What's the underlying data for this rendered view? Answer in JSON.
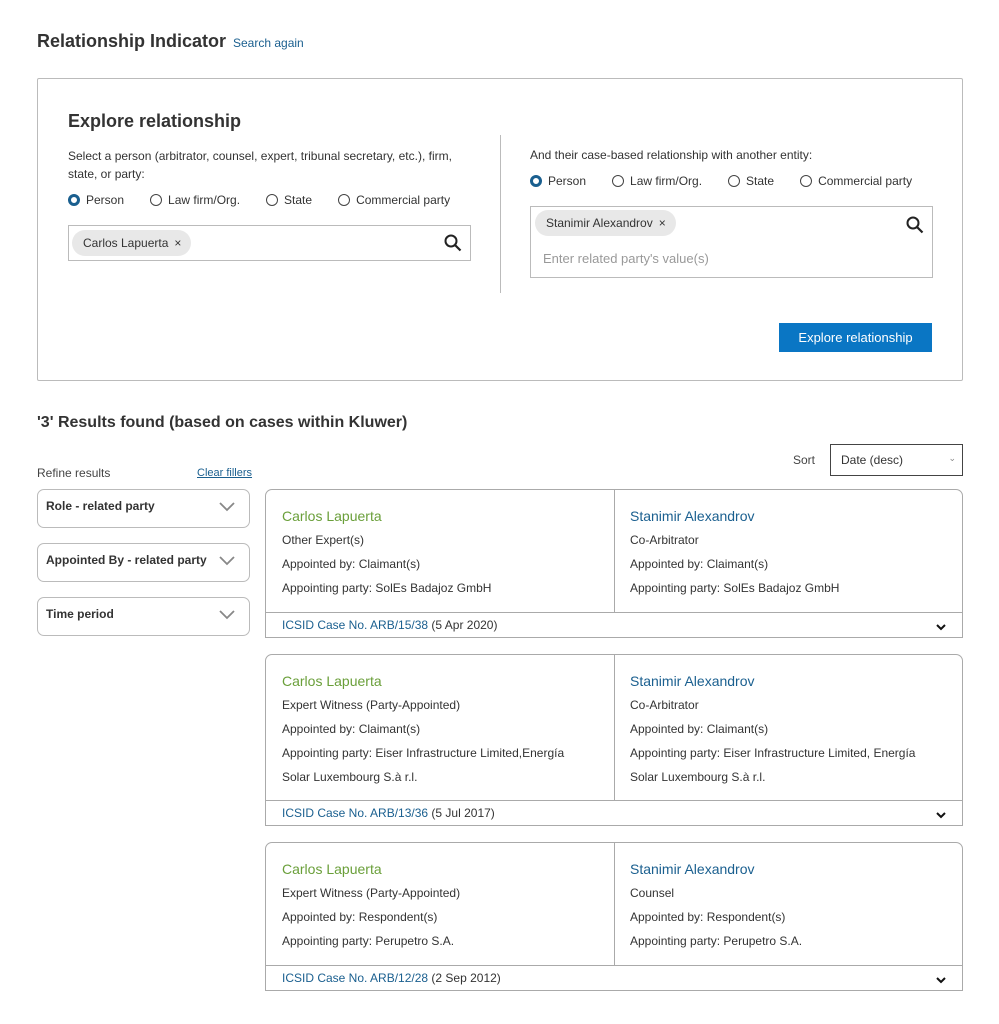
{
  "header": {
    "title": "Relationship Indicator",
    "search_again": "Search again"
  },
  "explore": {
    "title": "Explore relationship",
    "left": {
      "description": "Select a person (arbitrator, counsel, expert, tribunal secretary, etc.), firm, state, or party:",
      "radios": [
        "Person",
        "Law firm/Org.",
        "State",
        "Commercial party"
      ],
      "selected": "Person",
      "chip": "Carlos Lapuerta"
    },
    "right": {
      "description": "And their case-based relationship with another entity:",
      "radios": [
        "Person",
        "Law firm/Org.",
        "State",
        "Commercial party"
      ],
      "selected": "Person",
      "chip": "Stanimir Alexandrov",
      "placeholder": "Enter related party's value(s)"
    },
    "button": "Explore relationship"
  },
  "results": {
    "heading": "'3' Results found (based on cases within Kluwer)",
    "refine": "Refine results",
    "clear": "Clear fillers",
    "sort_label": "Sort",
    "sort_value": "Date (desc)",
    "filters": [
      "Role - related party",
      "Appointed By - related party",
      "Time period"
    ],
    "cards": [
      {
        "left": {
          "name": "Carlos Lapuerta",
          "role": "Other Expert(s)",
          "appointed": "Appointed by: Claimant(s)",
          "party": [
            "Appointing party: SolEs Badajoz GmbH"
          ]
        },
        "right": {
          "name": "Stanimir Alexandrov",
          "role": "Co-Arbitrator",
          "appointed": "Appointed by: Claimant(s)",
          "party": [
            "Appointing party: SolEs Badajoz GmbH"
          ]
        },
        "case": "ICSID Case No. ARB/15/38",
        "date": "(5 Apr 2020)"
      },
      {
        "left": {
          "name": "Carlos Lapuerta",
          "role": "Expert Witness (Party-Appointed)",
          "appointed": "Appointed by: Claimant(s)",
          "party": [
            "Appointing party: Eiser Infrastructure Limited,Energía",
            "Solar Luxembourg S.à r.l."
          ]
        },
        "right": {
          "name": "Stanimir Alexandrov",
          "role": "Co-Arbitrator",
          "appointed": "Appointed by: Claimant(s)",
          "party": [
            "Appointing party: Eiser Infrastructure Limited, Energía",
            "Solar Luxembourg S.à r.l."
          ]
        },
        "case": "ICSID Case No. ARB/13/36",
        "date": "(5 Jul 2017)"
      },
      {
        "left": {
          "name": "Carlos Lapuerta",
          "role": "Expert Witness (Party-Appointed)",
          "appointed": "Appointed by: Respondent(s)",
          "party": [
            "Appointing party: Perupetro S.A."
          ]
        },
        "right": {
          "name": "Stanimir Alexandrov",
          "role": "Counsel",
          "appointed": "Appointed by: Respondent(s)",
          "party": [
            "Appointing party: Perupetro S.A."
          ]
        },
        "case": "ICSID Case No. ARB/12/28",
        "date": "(2 Sep 2012)"
      }
    ]
  },
  "colors": {
    "accent": "#0a76c4",
    "link": "#1a5f8f",
    "name_green": "#6a9f3a"
  }
}
